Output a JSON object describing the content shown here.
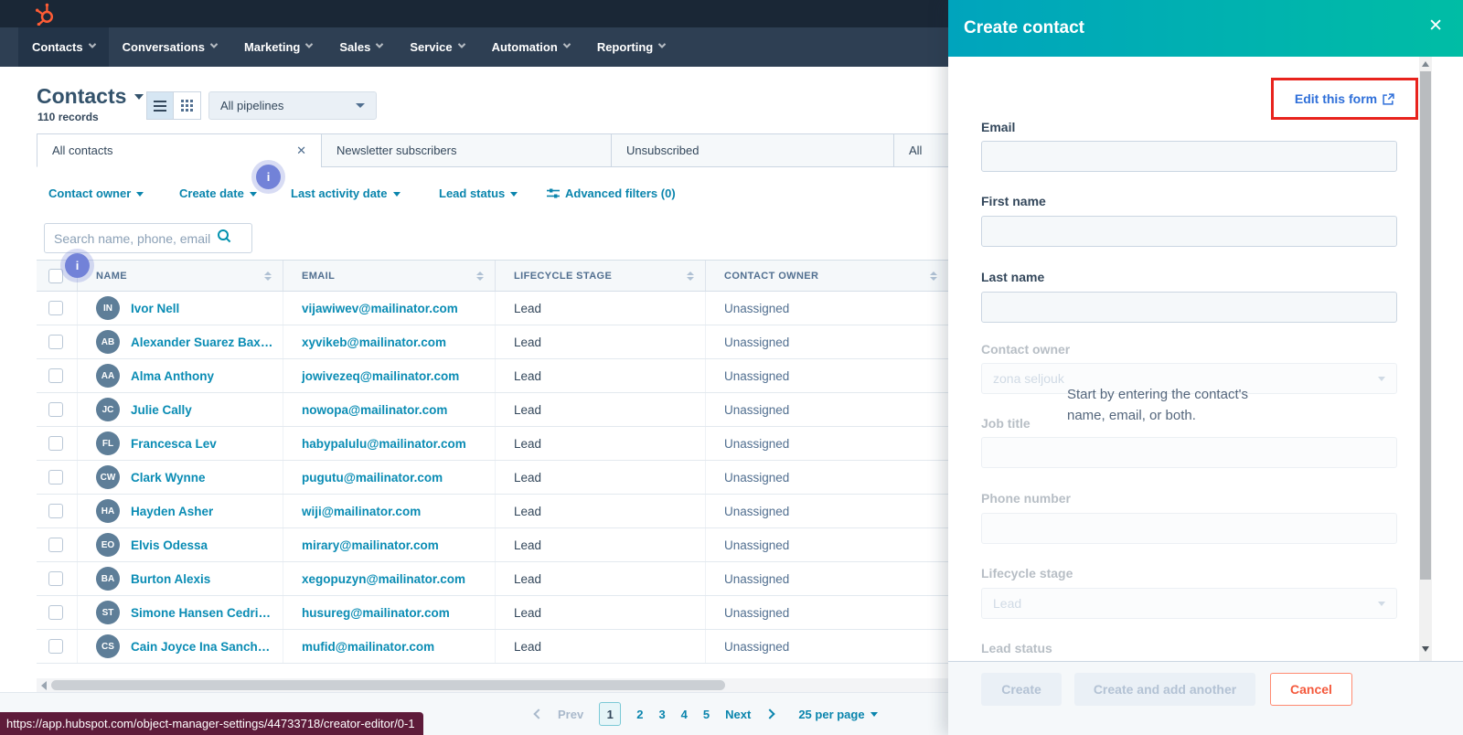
{
  "nav": {
    "items": [
      "Contacts",
      "Conversations",
      "Marketing",
      "Sales",
      "Service",
      "Automation",
      "Reporting"
    ]
  },
  "header": {
    "title": "Contacts",
    "records": "110 records",
    "pipelines": "All pipelines"
  },
  "tabs": [
    "All contacts",
    "Newsletter subscribers",
    "Unsubscribed",
    "All"
  ],
  "filters": [
    "Contact owner",
    "Create date",
    "Last activity date",
    "Lead status"
  ],
  "advanced_filters": "Advanced filters (0)",
  "info_icon": "i",
  "search": {
    "placeholder": "Search name, phone, email"
  },
  "table": {
    "columns": [
      "NAME",
      "EMAIL",
      "LIFECYCLE STAGE",
      "CONTACT OWNER"
    ],
    "rows": [
      {
        "initials": "IN",
        "name": "Ivor Nell",
        "email": "vijawiwev@mailinator.com",
        "stage": "Lead",
        "owner": "Unassigned"
      },
      {
        "initials": "AB",
        "name": "Alexander Suarez Bax…",
        "email": "xyvikeb@mailinator.com",
        "stage": "Lead",
        "owner": "Unassigned"
      },
      {
        "initials": "AA",
        "name": "Alma Anthony",
        "email": "jowivezeq@mailinator.com",
        "stage": "Lead",
        "owner": "Unassigned"
      },
      {
        "initials": "JC",
        "name": "Julie Cally",
        "email": "nowopa@mailinator.com",
        "stage": "Lead",
        "owner": "Unassigned"
      },
      {
        "initials": "FL",
        "name": "Francesca Lev",
        "email": "habypalulu@mailinator.com",
        "stage": "Lead",
        "owner": "Unassigned"
      },
      {
        "initials": "CW",
        "name": "Clark Wynne",
        "email": "pugutu@mailinator.com",
        "stage": "Lead",
        "owner": "Unassigned"
      },
      {
        "initials": "HA",
        "name": "Hayden Asher",
        "email": "wiji@mailinator.com",
        "stage": "Lead",
        "owner": "Unassigned"
      },
      {
        "initials": "EO",
        "name": "Elvis Odessa",
        "email": "mirary@mailinator.com",
        "stage": "Lead",
        "owner": "Unassigned"
      },
      {
        "initials": "BA",
        "name": "Burton Alexis",
        "email": "xegopuzyn@mailinator.com",
        "stage": "Lead",
        "owner": "Unassigned"
      },
      {
        "initials": "ST",
        "name": "Simone Hansen Cedri…",
        "email": "husureg@mailinator.com",
        "stage": "Lead",
        "owner": "Unassigned"
      },
      {
        "initials": "CS",
        "name": "Cain Joyce Ina Sanch…",
        "email": "mufid@mailinator.com",
        "stage": "Lead",
        "owner": "Unassigned"
      }
    ]
  },
  "pagination": {
    "prev": "Prev",
    "pages": [
      "1",
      "2",
      "3",
      "4",
      "5"
    ],
    "current_page": "1",
    "next": "Next",
    "per_page": "25 per page"
  },
  "status_url": "https://app.hubspot.com/object-manager-settings/44733718/creator-editor/0-1",
  "panel": {
    "title": "Create contact",
    "edit_link": "Edit this form",
    "tooltip": "Start by entering the contact's name, email, or both.",
    "email_label": "Email",
    "first_name_label": "First name",
    "last_name_label": "Last name",
    "contact_owner_label": "Contact owner",
    "contact_owner_value": "zona seljouk",
    "job_title_label": "Job title",
    "phone_label": "Phone number",
    "lifecycle_label": "Lifecycle stage",
    "lifecycle_value": "Lead",
    "lead_status_label": "Lead status",
    "create_label": "Create",
    "create_add_label": "Create and add another",
    "cancel_label": "Cancel"
  },
  "colors": {
    "brand_orange": "#ff5c35",
    "nav_bg": "#2e3f53",
    "panel_gradient_start": "#00a4bd",
    "panel_gradient_end": "#00bda5",
    "link_teal": "#0a85ad",
    "edit_link_blue": "#2e6fd9",
    "annotation_red": "#e8231d",
    "cancel_orange": "#f4593c",
    "status_bar_bg": "#5e1b3a",
    "info_badge": "#7282d8"
  }
}
